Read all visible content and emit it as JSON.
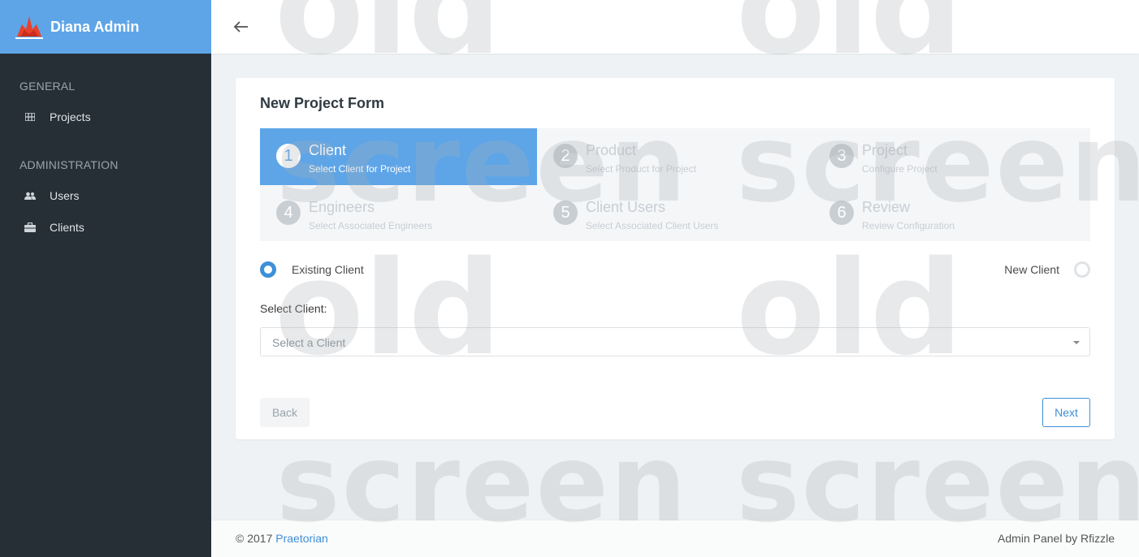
{
  "brand": {
    "title": "Diana Admin",
    "logo_icon": "flame-logo-icon"
  },
  "sidebar": {
    "sections": [
      {
        "label": "GENERAL",
        "items": [
          {
            "label": "Projects",
            "icon": "grid-icon"
          }
        ]
      },
      {
        "label": "ADMINISTRATION",
        "items": [
          {
            "label": "Users",
            "icon": "users-icon"
          },
          {
            "label": "Clients",
            "icon": "briefcase-icon"
          }
        ]
      }
    ]
  },
  "topbar": {
    "back_icon": "arrow-left-icon"
  },
  "form": {
    "title": "New Project Form",
    "steps": [
      {
        "num": "1",
        "title": "Client",
        "subtitle": "Select Client for Project",
        "active": true
      },
      {
        "num": "2",
        "title": "Product",
        "subtitle": "Select Product for Project",
        "active": false
      },
      {
        "num": "3",
        "title": "Project",
        "subtitle": "Configure Project",
        "active": false
      },
      {
        "num": "4",
        "title": "Engineers",
        "subtitle": "Select Associated Engineers",
        "active": false
      },
      {
        "num": "5",
        "title": "Client Users",
        "subtitle": "Select Associated Client Users",
        "active": false
      },
      {
        "num": "6",
        "title": "Review",
        "subtitle": "Review Configuration",
        "active": false
      }
    ],
    "radio_existing": {
      "label": "Existing Client",
      "checked": true
    },
    "radio_new": {
      "label": "New Client",
      "checked": false
    },
    "select_label": "Select Client:",
    "select_placeholder": "Select a Client",
    "back_label": "Back",
    "next_label": "Next"
  },
  "footer": {
    "copyright": "© 2017 ",
    "link": "Praetorian",
    "right": "Admin Panel by Rfizzle"
  },
  "watermark": {
    "word1": "old",
    "word2": "screen"
  },
  "colors": {
    "accent": "#5ea5e8",
    "sidebar": "#262f36",
    "primary": "#3d8fd8"
  }
}
